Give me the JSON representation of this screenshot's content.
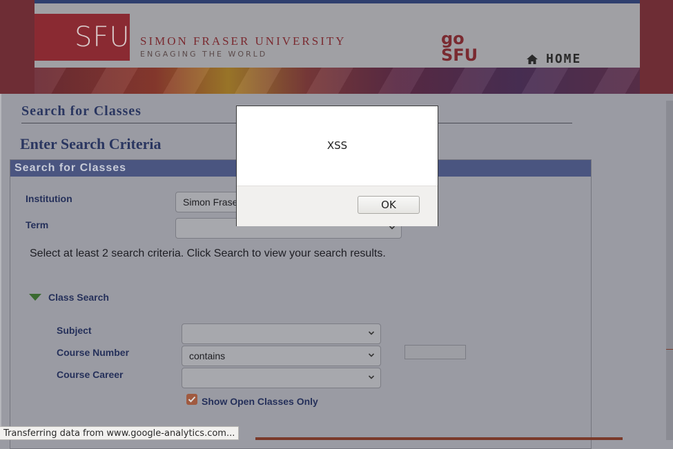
{
  "header": {
    "logo_text": "SFU",
    "university_name": "SIMON FRASER UNIVERSITY",
    "tagline": "ENGAGING THE WORLD",
    "gosfu_line1": "go",
    "gosfu_line2": "SFU",
    "home_label": "HOME",
    "home_icon": "home-icon"
  },
  "page": {
    "title": "Search for Classes",
    "section_title": "Enter Search Criteria",
    "panel_title": "Search for Classes"
  },
  "form": {
    "institution_label": "Institution",
    "institution_value": "Simon Fraser University",
    "term_label": "Term",
    "term_value": "",
    "instructions": "Select at least 2 search criteria. Click Search to view your search results.",
    "class_search_label": "Class Search",
    "subject_label": "Subject",
    "subject_value": "",
    "course_number_label": "Course Number",
    "course_number_operator": "contains",
    "course_number_value": "",
    "course_career_label": "Course Career",
    "course_career_value": "",
    "open_only_label": "Show Open Classes Only",
    "open_only_checked": true
  },
  "status_bar": {
    "text": "Transferring data from www.google-analytics.com..."
  },
  "alert": {
    "message": "XSS",
    "ok_label": "OK"
  },
  "colors": {
    "brand": "#a6192e",
    "panel_header": "#4a5580",
    "label_blue": "#25305a"
  }
}
